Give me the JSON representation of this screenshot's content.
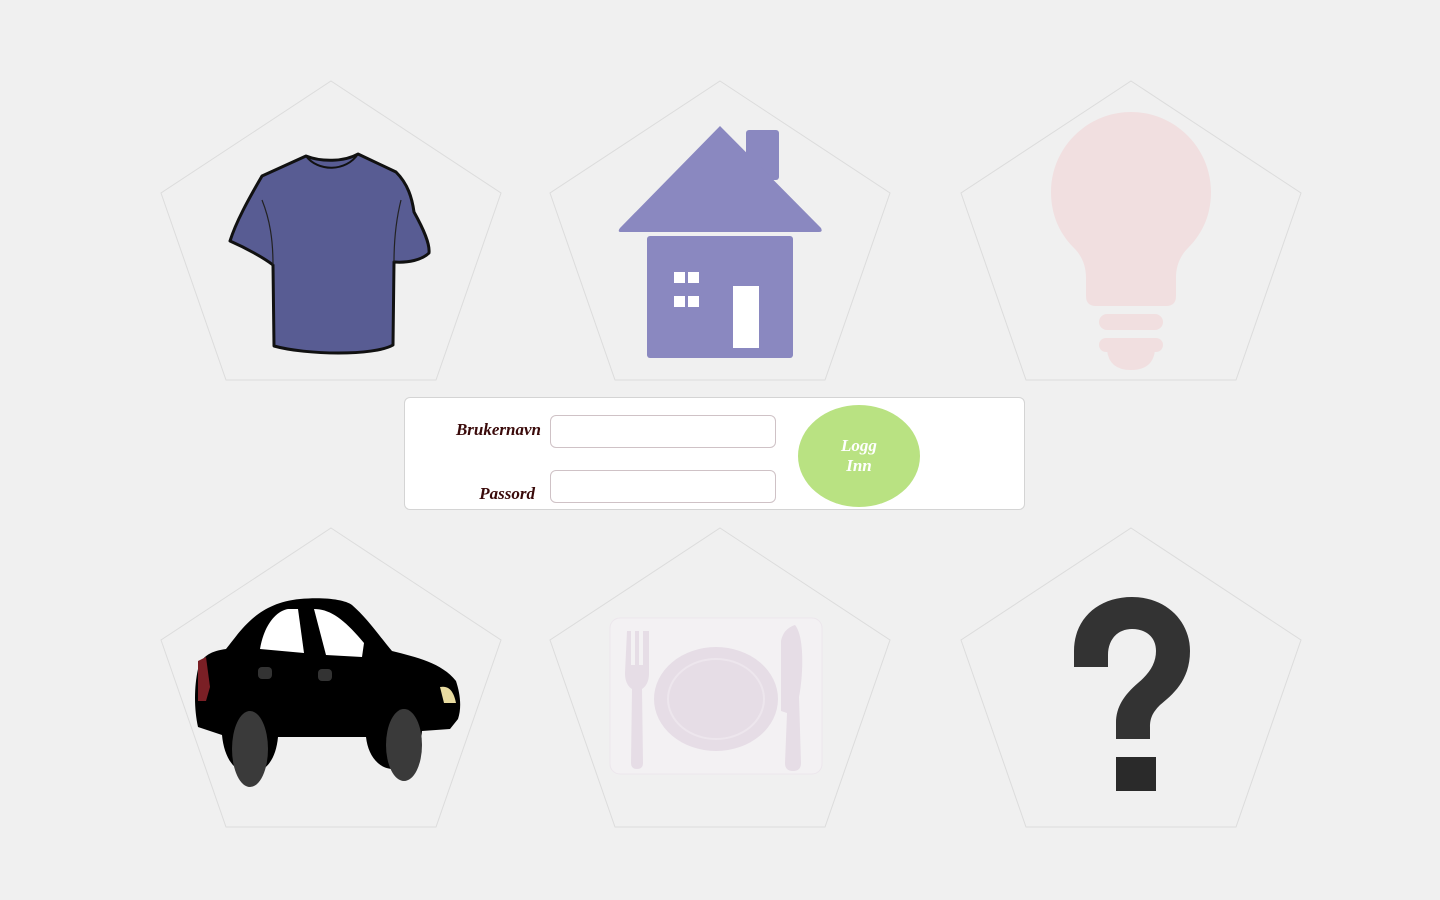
{
  "colors": {
    "background": "#f0f0f0",
    "pentagon_stroke": "#dcdcdc",
    "shirt": "#585c93",
    "house": "#8a88c0",
    "lightbulb": "#f1dfe0",
    "car": "#000000",
    "plate": "#e6dde6",
    "question": "#333333",
    "login_button": "#b9e282",
    "label_text": "#3a0a0a"
  },
  "tiles": [
    {
      "name": "shirt-tile",
      "icon": "t-shirt-icon"
    },
    {
      "name": "house-tile",
      "icon": "house-icon"
    },
    {
      "name": "lightbulb-tile",
      "icon": "lightbulb-icon"
    },
    {
      "name": "car-tile",
      "icon": "car-icon"
    },
    {
      "name": "dining-tile",
      "icon": "plate-cutlery-icon"
    },
    {
      "name": "question-tile",
      "icon": "question-mark-icon"
    }
  ],
  "login": {
    "username_label": "Brukernavn",
    "password_label": "Passord",
    "username_value": "",
    "password_value": "",
    "button_label": "Logg Inn"
  }
}
